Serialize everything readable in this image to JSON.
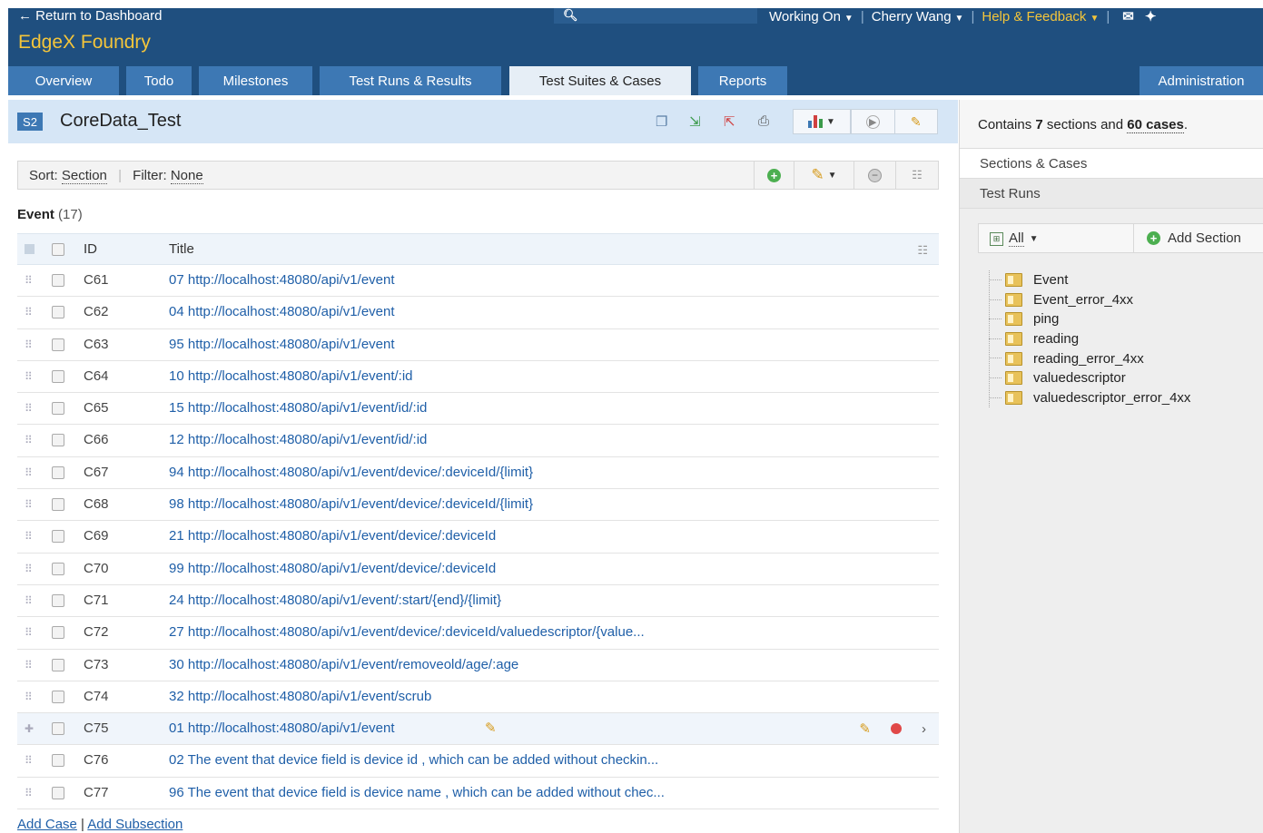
{
  "header": {
    "return_link": "← Return to Dashboard",
    "project_name": "EdgeX Foundry",
    "search_icon": "search-icon",
    "nav": {
      "working_on": "Working On",
      "user": "Cherry Wang",
      "help": "Help & Feedback"
    },
    "tabs": [
      {
        "label": "Overview"
      },
      {
        "label": "Todo"
      },
      {
        "label": "Milestones"
      },
      {
        "label": "Test Runs & Results"
      },
      {
        "label": "Test Suites & Cases"
      },
      {
        "label": "Reports"
      },
      {
        "label": "Administration"
      }
    ]
  },
  "suite": {
    "badge": "S2",
    "title": "CoreData_Test"
  },
  "toolbar": {
    "sort_label": "Sort:",
    "sort_value": "Section",
    "filter_label": "Filter:",
    "filter_value": "None"
  },
  "section": {
    "name": "Event",
    "count": "(17)"
  },
  "table": {
    "headers": {
      "id": "ID",
      "title": "Title"
    },
    "rows": [
      {
        "id": "C61",
        "title": "07 http://localhost:48080/api/v1/event"
      },
      {
        "id": "C62",
        "title": "04 http://localhost:48080/api/v1/event"
      },
      {
        "id": "C63",
        "title": "95 http://localhost:48080/api/v1/event"
      },
      {
        "id": "C64",
        "title": "10 http://localhost:48080/api/v1/event/:id"
      },
      {
        "id": "C65",
        "title": "15 http://localhost:48080/api/v1/event/id/:id"
      },
      {
        "id": "C66",
        "title": "12 http://localhost:48080/api/v1/event/id/:id"
      },
      {
        "id": "C67",
        "title": "94 http://localhost:48080/api/v1/event/device/:deviceId/{limit}"
      },
      {
        "id": "C68",
        "title": "98 http://localhost:48080/api/v1/event/device/:deviceId/{limit}"
      },
      {
        "id": "C69",
        "title": "21 http://localhost:48080/api/v1/event/device/:deviceId"
      },
      {
        "id": "C70",
        "title": "99 http://localhost:48080/api/v1/event/device/:deviceId"
      },
      {
        "id": "C71",
        "title": "24 http://localhost:48080/api/v1/event/:start/{end}/{limit}"
      },
      {
        "id": "C72",
        "title": "27 http://localhost:48080/api/v1/event/device/:deviceId/valuedescriptor/{value..."
      },
      {
        "id": "C73",
        "title": "30 http://localhost:48080/api/v1/event/removeold/age/:age"
      },
      {
        "id": "C74",
        "title": "32 http://localhost:48080/api/v1/event/scrub"
      },
      {
        "id": "C75",
        "title": "01 http://localhost:48080/api/v1/event"
      },
      {
        "id": "C76",
        "title": "02 The event that device field is device id , which can be added without checkin..."
      },
      {
        "id": "C77",
        "title": "96 The event that device field is device name , which can be added without chec..."
      }
    ]
  },
  "footer": {
    "add_case": "Add Case",
    "add_subsection": "Add Subsection"
  },
  "sidebar": {
    "summary_prefix": "Contains",
    "summary_sections": "7",
    "summary_middle": "sections and",
    "summary_cases": "60 cases",
    "tabs": [
      {
        "label": "Sections & Cases"
      },
      {
        "label": "Test Runs"
      }
    ],
    "tree_filter": "All",
    "add_section": "Add Section",
    "tree": [
      {
        "label": "Event"
      },
      {
        "label": "Event_error_4xx"
      },
      {
        "label": "ping"
      },
      {
        "label": "reading"
      },
      {
        "label": "reading_error_4xx"
      },
      {
        "label": "valuedescriptor"
      },
      {
        "label": "valuedescriptor_error_4xx"
      }
    ]
  },
  "colors": {
    "header_bg": "#1f4f7f",
    "tab_bg": "#3d78b4",
    "accent_yellow": "#f4c53a",
    "link_blue": "#1f5fa8"
  }
}
